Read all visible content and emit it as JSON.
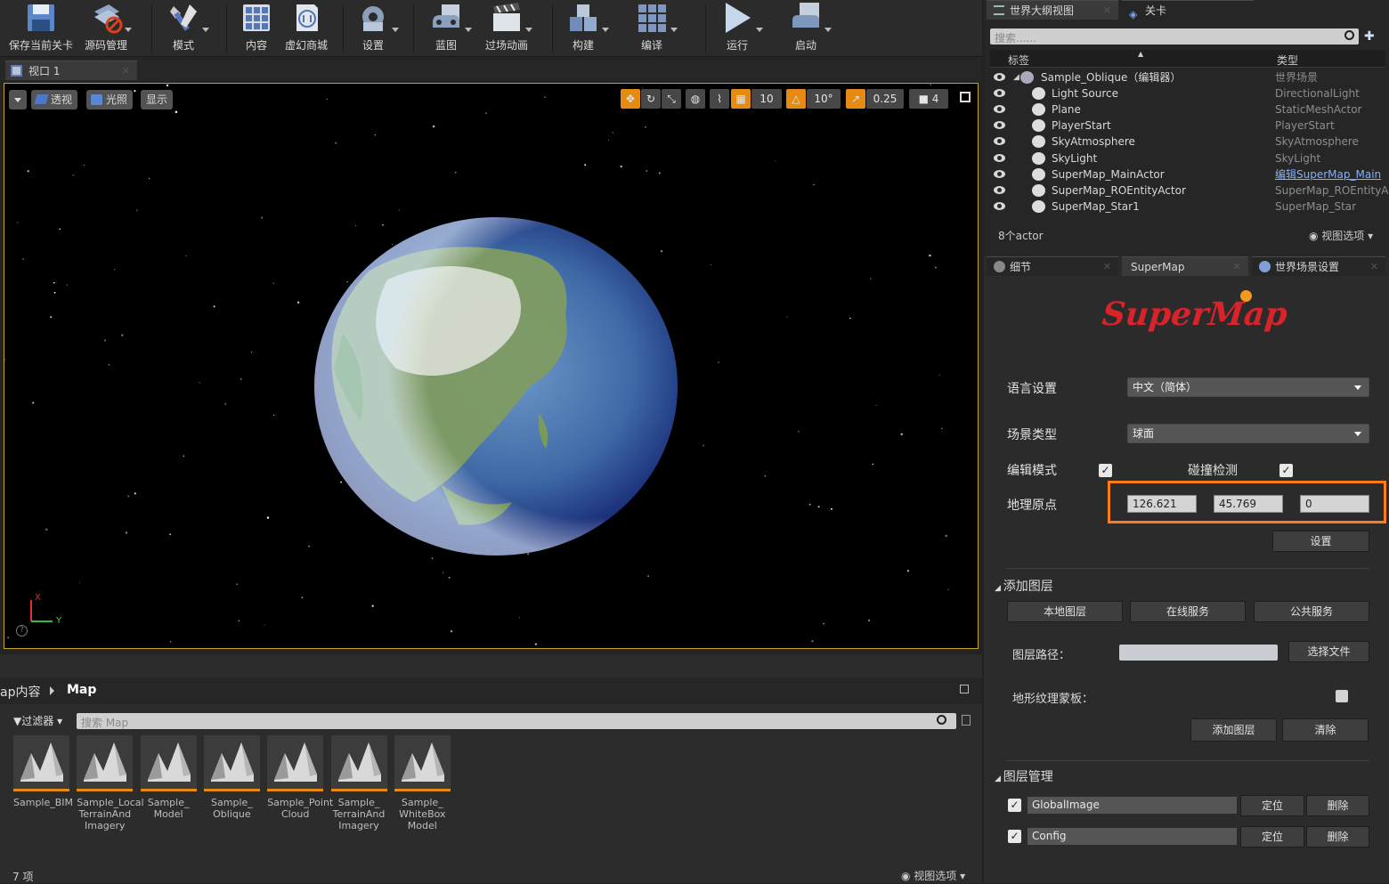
{
  "toolbar": {
    "save": "保存当前关卡",
    "source": "源码管理",
    "modes": "模式",
    "content": "内容",
    "marketplace": "虚幻商城",
    "settings": "设置",
    "blueprints": "蓝图",
    "cinematics": "过场动画",
    "build": "构建",
    "compile": "编译",
    "play": "运行",
    "launch": "启动"
  },
  "viewport": {
    "tab": "视口 1",
    "perspective": "透视",
    "lit": "光照",
    "show": "显示",
    "grid": "10",
    "angle": "10°",
    "scale": "0.25",
    "speed": "4",
    "axis_x": "X",
    "axis_y": "Y"
  },
  "outliner": {
    "tab": "世界大纲视图",
    "tab2": "关卡",
    "search_placeholder": "搜索......",
    "col_label": "标签",
    "col_type": "类型",
    "rows": [
      {
        "name": "Sample_Oblique（编辑器）",
        "type": "世界场景"
      },
      {
        "name": "Light Source",
        "type": "DirectionalLight"
      },
      {
        "name": "Plane",
        "type": "StaticMeshActor"
      },
      {
        "name": "PlayerStart",
        "type": "PlayerStart"
      },
      {
        "name": "SkyAtmosphere",
        "type": "SkyAtmosphere"
      },
      {
        "name": "SkyLight",
        "type": "SkyLight"
      },
      {
        "name": "SuperMap_MainActor",
        "type": "编辑SuperMap_Main"
      },
      {
        "name": "SuperMap_ROEntityActor",
        "type": "SuperMap_ROEntityAc"
      },
      {
        "name": "SuperMap_Star1",
        "type": "SuperMap_Star"
      }
    ],
    "count": "8个actor",
    "view_options": "视图选项"
  },
  "details": {
    "tab_details": "细节",
    "tab_supermap": "SuperMap",
    "tab_world": "世界场景设置",
    "logo": "SuperMap",
    "lang_label": "语言设置",
    "lang_value": "中文（简体）",
    "scene_label": "场景类型",
    "scene_value": "球面",
    "edit_mode": "编辑模式",
    "collision": "碰撞检测",
    "geo_origin": "地理原点",
    "lon": "126.621",
    "lat": "45.769",
    "alt": "0",
    "set_btn": "设置",
    "add_layer_section": "添加图层",
    "local_layer": "本地图层",
    "online_service": "在线服务",
    "public_service": "公共服务",
    "layer_path": "图层路径：",
    "choose_file": "选择文件",
    "terrain_mask": "地形纹理蒙板：",
    "add_layer_btn": "添加图层",
    "clear_btn": "清除",
    "layer_mgmt": "图层管理",
    "layers": [
      {
        "name": "GlobalImage",
        "locate": "定位",
        "delete": "删除"
      },
      {
        "name": "Config",
        "locate": "定位",
        "delete": "删除"
      }
    ]
  },
  "content": {
    "breadcrumb_root": "ap内容",
    "breadcrumb_current": "Map",
    "filter": "过滤器",
    "search_placeholder": "搜索 Map",
    "assets": [
      "Sample_BIM",
      "Sample_Local TerrainAnd Imagery",
      "Sample_ Model",
      "Sample_ Oblique",
      "Sample_Point Cloud",
      "Sample_ TerrainAnd Imagery",
      "Sample_ WhiteBox Model"
    ],
    "count": "7 项",
    "view_options": "视图选项"
  },
  "colors": {
    "accent": "#e58a12",
    "highlight_box": "#ff7b1c",
    "logo_red": "#d8232a"
  }
}
